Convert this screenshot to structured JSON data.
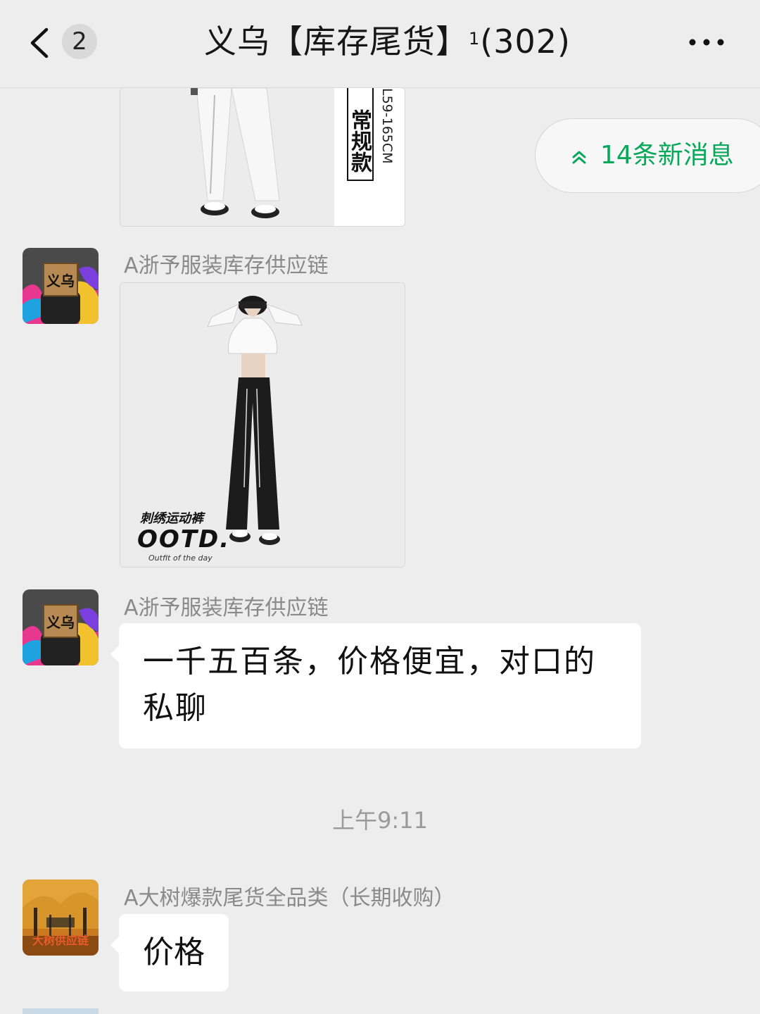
{
  "header": {
    "back_count": "2",
    "title": "义乌【库存尾货】",
    "title_sup": "1",
    "member_count": "(302)"
  },
  "new_messages": {
    "label": "14条新消息"
  },
  "messages": [
    {
      "type": "image",
      "image": {
        "tag_text": "常规款",
        "size_text": "L59-165CM"
      }
    },
    {
      "type": "image",
      "sender": "A浙予服装库存供应链",
      "image": {
        "caption_cn": "刺绣运动裤",
        "caption_main": "OOTD.",
        "caption_sub": "Outfit of the day"
      }
    },
    {
      "type": "text",
      "sender": "A浙予服装库存供应链",
      "text": "一千五百条，价格便宜，对口的私聊"
    },
    {
      "type": "time",
      "text": "上午9:11"
    },
    {
      "type": "text",
      "sender": "A大树爆款尾货全品类（长期收购）",
      "text": "价格"
    }
  ],
  "avatar_texts": {
    "a1": "义乌",
    "a3": "大树供应链"
  },
  "colors": {
    "background": "#ededed",
    "accent_green": "#07a85a",
    "bubble": "#ffffff"
  }
}
